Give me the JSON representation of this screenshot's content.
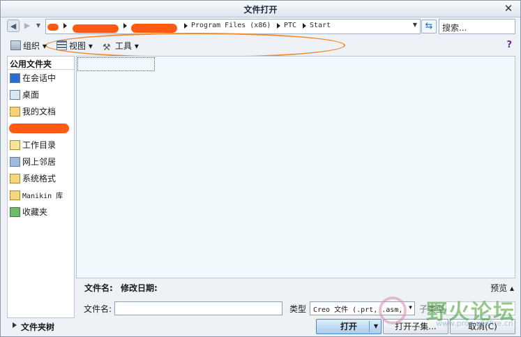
{
  "window": {
    "title": "文件打开",
    "close_glyph": "✕"
  },
  "address": {
    "crumbs": [
      "Program Files (x86)",
      "PTC",
      "Start"
    ],
    "search_placeholder": "搜索..."
  },
  "toolbar": {
    "organize": "组织 ▾",
    "view": "视图 ▾",
    "tools": "工具 ▾",
    "help_glyph": "?"
  },
  "sidebar": {
    "heading": "公用文件夹",
    "items": [
      {
        "label": "在会话中",
        "icon": "session-icon"
      },
      {
        "label": "桌面",
        "icon": "desktop-icon"
      },
      {
        "label": "我的文档",
        "icon": "documents-icon"
      },
      {
        "label": "工作目录",
        "icon": "working-dir-icon"
      },
      {
        "label": "网上邻居",
        "icon": "network-icon"
      },
      {
        "label": "系统格式",
        "icon": "system-format-icon"
      },
      {
        "label": "Manikin 库",
        "icon": "manikin-icon"
      },
      {
        "label": "收藏夹",
        "icon": "favorites-icon"
      }
    ],
    "folder_tree": "文件夹树"
  },
  "details": {
    "name_label": "文件名:",
    "date_label": "修改日期:",
    "preview": "预览 ▴"
  },
  "bottom": {
    "filename_label": "文件名:",
    "filename_value": "",
    "type_label": "类型",
    "type_value": "Creo 文件 (.prt, .asm,",
    "subtype_label": "子类型"
  },
  "buttons": {
    "open": "打开",
    "open_subset": "打开子集...",
    "cancel": "取消(C)"
  },
  "watermark": {
    "text": "野火论坛",
    "url": "www.proewildfire.cn"
  }
}
